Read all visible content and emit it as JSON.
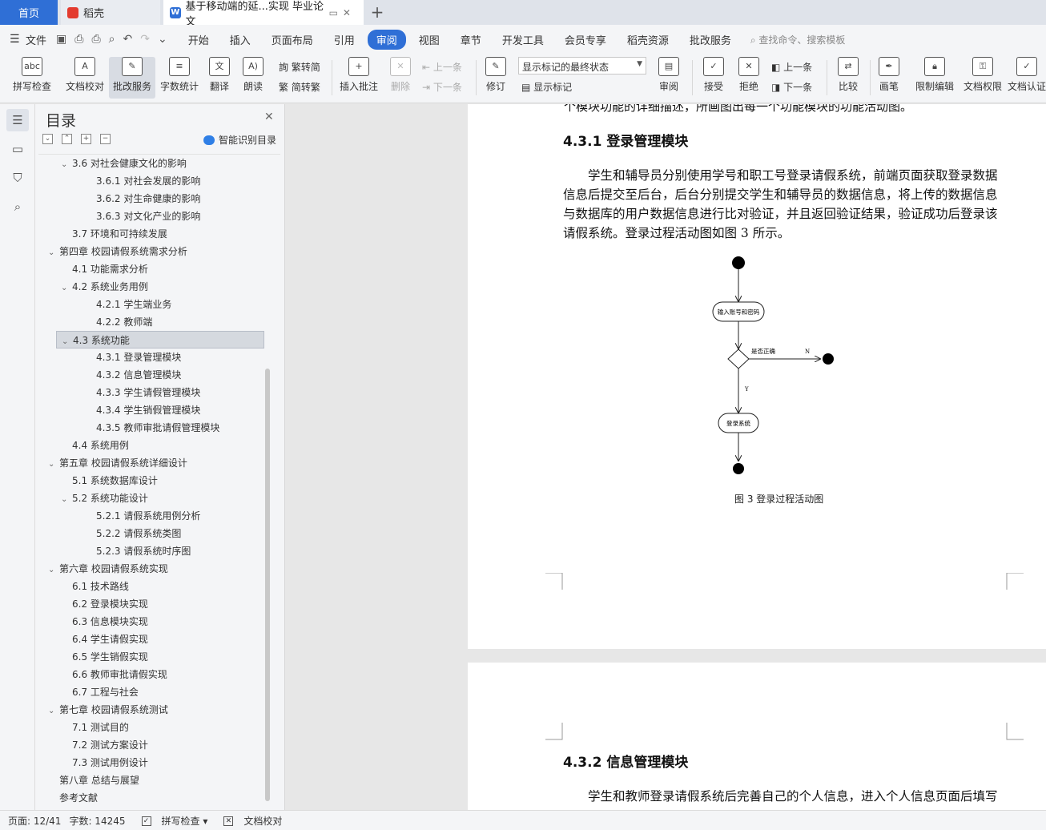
{
  "tabs": {
    "home": "首页",
    "daoke": "稻壳",
    "doc": "基于移动端的延...实现 毕业论文"
  },
  "menu": {
    "file": "文件",
    "items": [
      "开始",
      "插入",
      "页面布局",
      "引用",
      "审阅",
      "视图",
      "章节",
      "开发工具",
      "会员专享",
      "稻壳资源",
      "批改服务"
    ],
    "active": "审阅",
    "search": "查找命令、搜索模板"
  },
  "ribbon": {
    "spell": "拼写检查",
    "proof": "文档校对",
    "correction": "批改服务",
    "wordcount": "字数统计",
    "translate": "翻译",
    "read": "朗读",
    "t2s": "繁转简",
    "s2t": "简转繁",
    "insert_comment": "插入批注",
    "delete": "删除",
    "prev_comment": "上一条",
    "next_comment": "下一条",
    "track": "修订",
    "markup_state": "显示标记的最终状态",
    "show_markup": "显示标记",
    "review": "审阅",
    "accept": "接受",
    "reject": "拒绝",
    "prev_change": "上一条",
    "next_change": "下一条",
    "compare": "比较",
    "pen": "画笔",
    "restrict": "限制编辑",
    "permission": "文档权限",
    "certify": "文档认证"
  },
  "toc": {
    "title": "目录",
    "smart": "智能识别目录",
    "items": [
      {
        "text": "3.6  对社会健康文化的影响",
        "level": 2,
        "caret": "v"
      },
      {
        "text": "3.6.1  对社会发展的影响",
        "level": 3
      },
      {
        "text": "3.6.2  对生命健康的影响",
        "level": 3
      },
      {
        "text": "3.6.3  对文化产业的影响",
        "level": 3
      },
      {
        "text": "3.7  环境和可持续发展",
        "level": 2
      },
      {
        "text": "第四章  校园请假系统需求分析",
        "level": 1,
        "caret": "v"
      },
      {
        "text": "4.1  功能需求分析",
        "level": 2
      },
      {
        "text": "4.2  系统业务用例",
        "level": 2,
        "caret": "v"
      },
      {
        "text": "4.2.1  学生端业务",
        "level": 3
      },
      {
        "text": "4.2.2  教师端",
        "level": 3
      },
      {
        "text": "4.3  系统功能",
        "level": 2,
        "caret": "v",
        "selected": true
      },
      {
        "text": "4.3.1  登录管理模块",
        "level": 3
      },
      {
        "text": "4.3.2  信息管理模块",
        "level": 3
      },
      {
        "text": "4.3.3  学生请假管理模块",
        "level": 3
      },
      {
        "text": "4.3.4  学生销假管理模块",
        "level": 3
      },
      {
        "text": "4.3.5  教师审批请假管理模块",
        "level": 3
      },
      {
        "text": "4.4  系统用例",
        "level": 2
      },
      {
        "text": "第五章  校园请假系统详细设计",
        "level": 1,
        "caret": "v"
      },
      {
        "text": "5.1  系统数据库设计",
        "level": 2
      },
      {
        "text": "5.2  系统功能设计",
        "level": 2,
        "caret": "v"
      },
      {
        "text": "5.2.1  请假系统用例分析",
        "level": 3
      },
      {
        "text": "5.2.2  请假系统类图",
        "level": 3
      },
      {
        "text": "5.2.3  请假系统时序图",
        "level": 3
      },
      {
        "text": "第六章  校园请假系统实现",
        "level": 1,
        "caret": "v"
      },
      {
        "text": "6.1  技术路线",
        "level": 2
      },
      {
        "text": "6.2  登录模块实现",
        "level": 2
      },
      {
        "text": "6.3  信息模块实现",
        "level": 2
      },
      {
        "text": "6.4  学生请假实现",
        "level": 2
      },
      {
        "text": "6.5  学生销假实现",
        "level": 2
      },
      {
        "text": "6.6  教师审批请假实现",
        "level": 2
      },
      {
        "text": "6.7  工程与社会",
        "level": 2
      },
      {
        "text": "第七章  校园请假系统测试",
        "level": 1,
        "caret": "v"
      },
      {
        "text": "7.1  测试目的",
        "level": 2
      },
      {
        "text": "7.2  测试方案设计",
        "level": 2
      },
      {
        "text": "7.3  测试用例设计",
        "level": 2
      },
      {
        "text": "第八章  总结与展望",
        "level": 1
      },
      {
        "text": "参考文献",
        "level": 1
      }
    ]
  },
  "document": {
    "cut_line": "个模块功能的详细描述，所画图出每一个功能模块的功能活动图。",
    "section1_heading": "4.3.1  登录管理模块",
    "section1_para": "学生和辅导员分别使用学号和职工号登录请假系统，前端页面获取登录数据信息后提交至后台，后台分别提交学生和辅导员的数据信息，将上传的数据信息与数据库的用户数据信息进行比对验证，并且返回验证结果，验证成功后登录该请假系统。登录过程活动图如图 3 所示。",
    "diagram": {
      "node_input": "输入账号和密码",
      "decision_label": "是否正确",
      "no_label": "N",
      "yes_label": "Y",
      "node_login": "登录系统"
    },
    "figure_caption": "图  3  登录过程活动图",
    "section2_heading": "4.3.2  信息管理模块",
    "section2_para": "学生和教师登录请假系统后完善自己的个人信息，进入个人信息页面后填写"
  },
  "status": {
    "page": "页面: 12/41",
    "words": "字数: 14245",
    "spell": "拼写检查",
    "proof": "文档校对"
  }
}
